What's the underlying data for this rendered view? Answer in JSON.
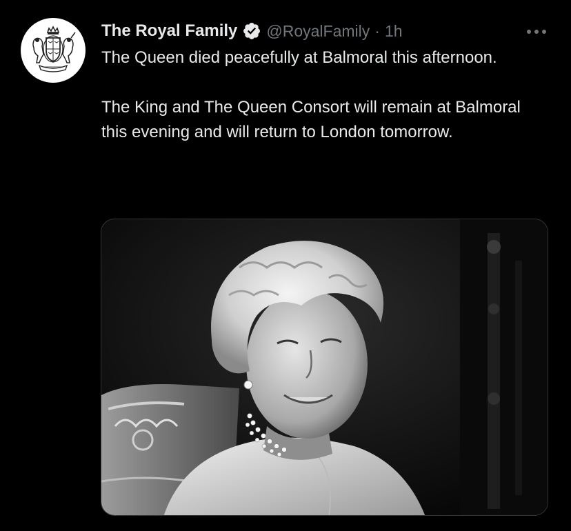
{
  "tweet": {
    "author": {
      "display_name": "The Royal Family",
      "handle": "@RoyalFamily",
      "verified": true,
      "avatar_icon": "royal-coat-of-arms-icon"
    },
    "separator": "·",
    "time": "1h",
    "text": {
      "paragraph_1": "The Queen died peacefully at Balmoral this afternoon.",
      "paragraph_2": "The King and The Queen Consort will remain at Balmoral this evening and will return to London tomorrow."
    },
    "media": {
      "type": "photo",
      "style": "black-and-white portrait"
    },
    "more_icon": "ellipsis-icon"
  },
  "colors": {
    "background": "#000000",
    "primary_text": "#e7e9ea",
    "secondary_text": "#71767b",
    "verified_badge": "#e7e9ea",
    "media_border": "#333639"
  }
}
